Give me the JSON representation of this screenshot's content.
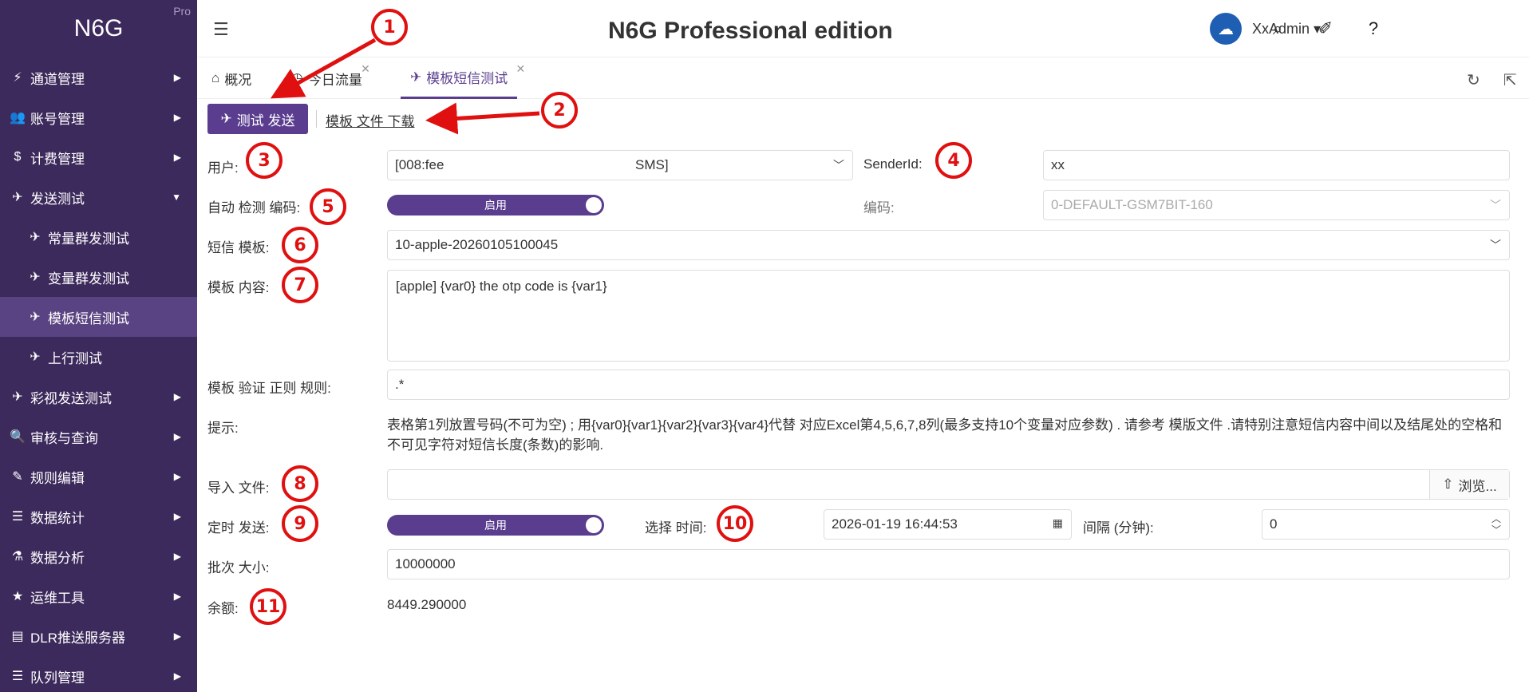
{
  "sidebar": {
    "brand": "N6G",
    "brand_badge": "Pro",
    "items": [
      {
        "label": "通道管理",
        "icon": "bolt-icon"
      },
      {
        "label": "账号管理",
        "icon": "users-icon"
      },
      {
        "label": "计费管理",
        "icon": "dollar-icon"
      },
      {
        "label": "发送测试",
        "icon": "paper-plane-icon",
        "expanded": true
      },
      {
        "label": "常量群发测试",
        "icon": "paper-plane-icon",
        "sub": true
      },
      {
        "label": "变量群发测试",
        "icon": "paper-plane-icon",
        "sub": true
      },
      {
        "label": "模板短信测试",
        "icon": "paper-plane-icon",
        "sub": true,
        "active": true
      },
      {
        "label": "上行测试",
        "icon": "paper-plane-icon",
        "sub": true
      },
      {
        "label": "彩视发送测试",
        "icon": "paper-plane-icon"
      },
      {
        "label": "审核与查询",
        "icon": "search-icon"
      },
      {
        "label": "规则编辑",
        "icon": "edit-icon"
      },
      {
        "label": "数据统计",
        "icon": "database-icon"
      },
      {
        "label": "数据分析",
        "icon": "flask-icon"
      },
      {
        "label": "运维工具",
        "icon": "star-icon"
      },
      {
        "label": "DLR推送服务器",
        "icon": "server-icon"
      },
      {
        "label": "队列管理",
        "icon": "list-icon"
      }
    ]
  },
  "header": {
    "title": "N6G Professional edition",
    "username": "XxAdmin"
  },
  "tabs": [
    {
      "label": "概况",
      "icon": "home-icon"
    },
    {
      "label": "今日流量",
      "icon": "clock-icon",
      "closable": true
    },
    {
      "label": "模板短信测试",
      "icon": "paper-plane-icon",
      "closable": true,
      "active": true
    }
  ],
  "toolbar": {
    "send_label": "测试 发送",
    "download_label": "模板 文件 下载"
  },
  "form": {
    "user_label": "用户:",
    "user_value_left": "[008:fee",
    "user_value_right": "SMS]",
    "senderid_label": "SenderId:",
    "senderid_value": "xx",
    "autodetect_label": "自动 检测 编码:",
    "autodetect_toggle": "启用",
    "encoding_label": "编码:",
    "encoding_value": "0-DEFAULT-GSM7BIT-160",
    "template_label": "短信 模板:",
    "template_value": "10-apple-20260105100045",
    "content_label": "模板 内容:",
    "content_value": "[apple] {var0} the otp code is {var1}",
    "regex_label": "模板 验证 正则 规则:",
    "regex_value": ".*",
    "hint_label": "提示:",
    "hint_text": "表格第1列放置号码(不可为空) ; 用{var0}{var1}{var2}{var3}{var4}代替 对应Excel第4,5,6,7,8列(最多支持10个变量对应参数) . 请参考 模版文件 .请特别注意短信内容中间以及结尾处的空格和不可见字符对短信长度(条数)的影响.",
    "import_label": "导入 文件:",
    "browse_label": "浏览...",
    "schedule_label": "定时 发送:",
    "schedule_toggle": "启用",
    "time_label": "选择 时间:",
    "time_value": "2026-01-19 16:44:53",
    "interval_label": "间隔 (分钟):",
    "interval_value": "0",
    "batch_label": "批次 大小:",
    "batch_value": "10000000",
    "balance_label": "余额:",
    "balance_value": "8449.290000"
  },
  "annotations": [
    "1",
    "2",
    "3",
    "4",
    "5",
    "6",
    "7",
    "8",
    "9",
    "10",
    "11"
  ],
  "colors": {
    "sidebar_bg": "#3d2a5c",
    "accent": "#5a3d8f",
    "annotation": "#e01010"
  }
}
